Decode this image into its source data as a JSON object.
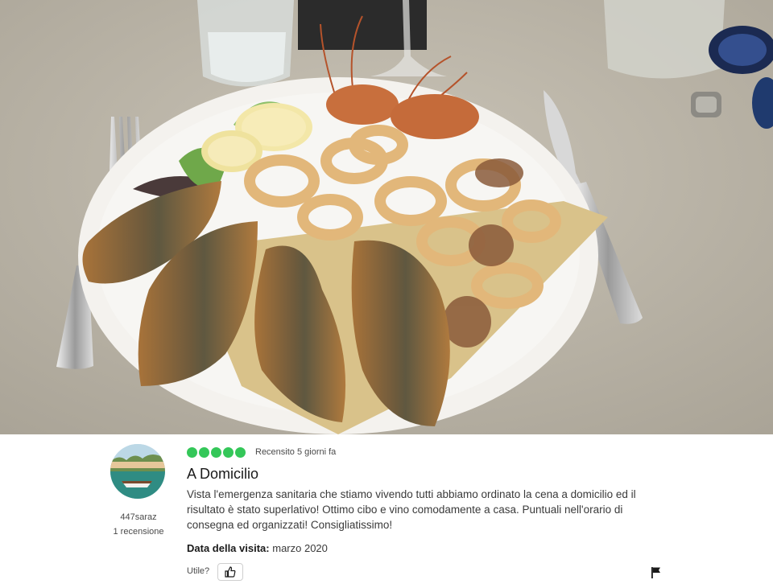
{
  "photo": {
    "icon": "fried-seafood-photo"
  },
  "review": {
    "user": {
      "name": "447saraz",
      "contributions": "1 recensione"
    },
    "rating": {
      "bubbles": 5,
      "max": 5,
      "color": "#34c759"
    },
    "when": "Recensito 5 giorni fa",
    "title": "A Domicilio",
    "text": "Vista l'emergenza sanitaria che stiamo vivendo tutti abbiamo ordinato la cena a domicilio ed il risultato è stato superlativo! Ottimo cibo e vino comodamente a casa. Puntuali nell'orario di consegna ed organizzati! Consigliatissimo!",
    "visit_label": "Data della visita:",
    "visit_value": "marzo 2020",
    "helpful_label": "Utile?",
    "like_icon": "thumbs-up-icon",
    "flag_icon": "flag-icon"
  }
}
